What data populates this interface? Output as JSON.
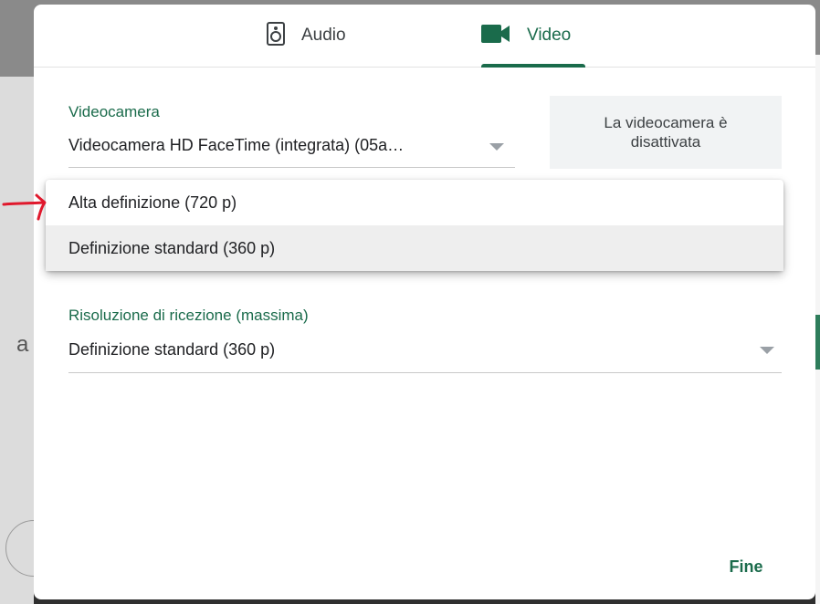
{
  "dialog": {
    "tabs": [
      {
        "label": "Audio",
        "icon": "speaker-icon",
        "active": false
      },
      {
        "label": "Video",
        "icon": "videocam-icon",
        "active": true
      }
    ],
    "camera": {
      "label": "Videocamera",
      "value": "Videocamera HD FaceTime (integrata) (05a…"
    },
    "camera_status": "La videocamera è disattivata",
    "send_resolution_menu": {
      "options": [
        "Alta definizione (720 p)",
        "Definizione standard (360 p)"
      ],
      "highlighted": "Definizione standard (360 p)"
    },
    "receive_resolution": {
      "label": "Risoluzione di ricezione (massima)",
      "value": "Definizione standard (360 p)"
    },
    "done_label": "Fine"
  },
  "background": {
    "partial_text": "a"
  },
  "colors": {
    "accent": "#1a6b4b",
    "annotation": "#e0182c",
    "menu_highlight": "#eeeeee"
  }
}
